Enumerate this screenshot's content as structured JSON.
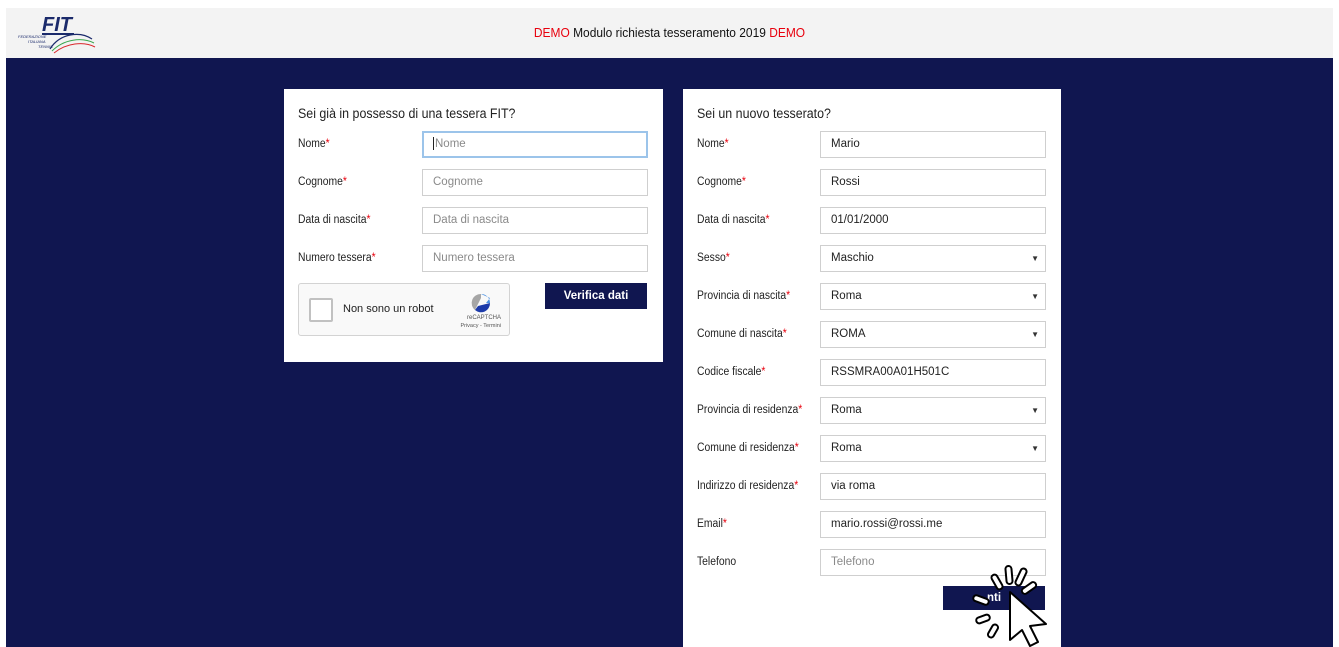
{
  "header": {
    "logo_text": "FIT",
    "logo_subtext": "FEDERAZIONE ITALIANA TENNIS",
    "demo_left": "DEMO",
    "title": " Modulo richiesta tesseramento 2019 ",
    "demo_right": "DEMO",
    "demo_color": "#e8000d"
  },
  "colors": {
    "background": "#101650",
    "button": "#101650",
    "required": "#e8000d"
  },
  "existing_member": {
    "title": "Sei già in possesso di una tessera FIT?",
    "required_mark": "*",
    "fields": [
      {
        "label": "Nome",
        "placeholder": "Nome",
        "value": "",
        "focused": true
      },
      {
        "label": "Cognome",
        "placeholder": "Cognome",
        "value": ""
      },
      {
        "label": "Data di nascita",
        "placeholder": "Data di nascita",
        "value": ""
      },
      {
        "label": "Numero tessera",
        "placeholder": "Numero tessera",
        "value": ""
      }
    ],
    "recaptcha": {
      "label": "Non sono un robot",
      "brand": "reCAPTCHA",
      "terms": "Privacy - Termini",
      "checked": false
    },
    "verify_button": "Verifica dati"
  },
  "new_member": {
    "title": "Sei un nuovo tesserato?",
    "required_mark": "*",
    "fields": [
      {
        "label": "Nome",
        "required": true,
        "type": "text",
        "value": "Mario"
      },
      {
        "label": "Cognome",
        "required": true,
        "type": "text",
        "value": "Rossi"
      },
      {
        "label": "Data di nascita",
        "required": true,
        "type": "text",
        "value": "01/01/2000"
      },
      {
        "label": "Sesso",
        "required": true,
        "type": "select",
        "value": "Maschio"
      },
      {
        "label": "Provincia di nascita",
        "required": true,
        "type": "select",
        "value": "Roma"
      },
      {
        "label": "Comune di nascita",
        "required": true,
        "type": "select",
        "value": "ROMA"
      },
      {
        "label": "Codice fiscale",
        "required": true,
        "type": "text",
        "value": "RSSMRA00A01H501C"
      },
      {
        "label": "Provincia di residenza",
        "required": true,
        "type": "select",
        "value": "Roma"
      },
      {
        "label": "Comune di residenza",
        "required": true,
        "type": "select",
        "value": "Roma"
      },
      {
        "label": "Indirizzo di residenza",
        "required": true,
        "type": "text",
        "value": "via roma"
      },
      {
        "label": "Email",
        "required": true,
        "type": "text",
        "value": "mario.rossi@rossi.me"
      },
      {
        "label": "Telefono",
        "required": false,
        "type": "text",
        "value": "",
        "placeholder": "Telefono"
      }
    ],
    "submit_button": "nti"
  },
  "icons": {
    "dropdown": "chevron-down-icon",
    "cursor": "click-cursor-icon"
  }
}
